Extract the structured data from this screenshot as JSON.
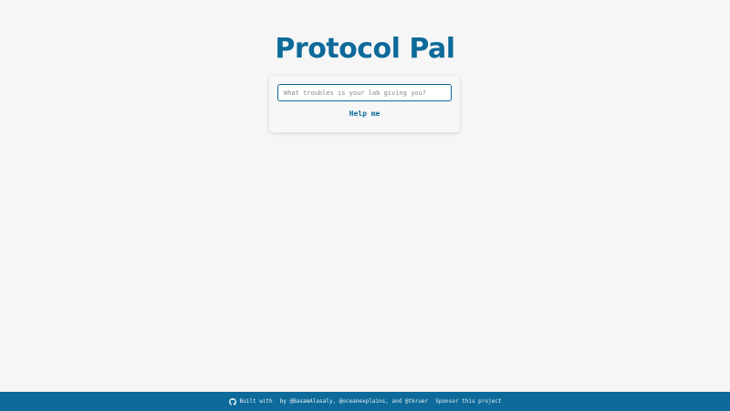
{
  "header": {
    "title": "Protocol Pal"
  },
  "search": {
    "placeholder": "What troubles is your lab giving you?",
    "value": ""
  },
  "actions": {
    "help_label": "Help me"
  },
  "footer": {
    "built_with": "Built with",
    "by_text": "by @BasamAlasaly, @oceanexplains, and @tkruer",
    "sponsor_label": "Sponsor this project"
  },
  "colors": {
    "brand": "#0d6a9a",
    "background": "#f6f6f6"
  },
  "icons": {
    "footer_icon": "github-icon"
  }
}
